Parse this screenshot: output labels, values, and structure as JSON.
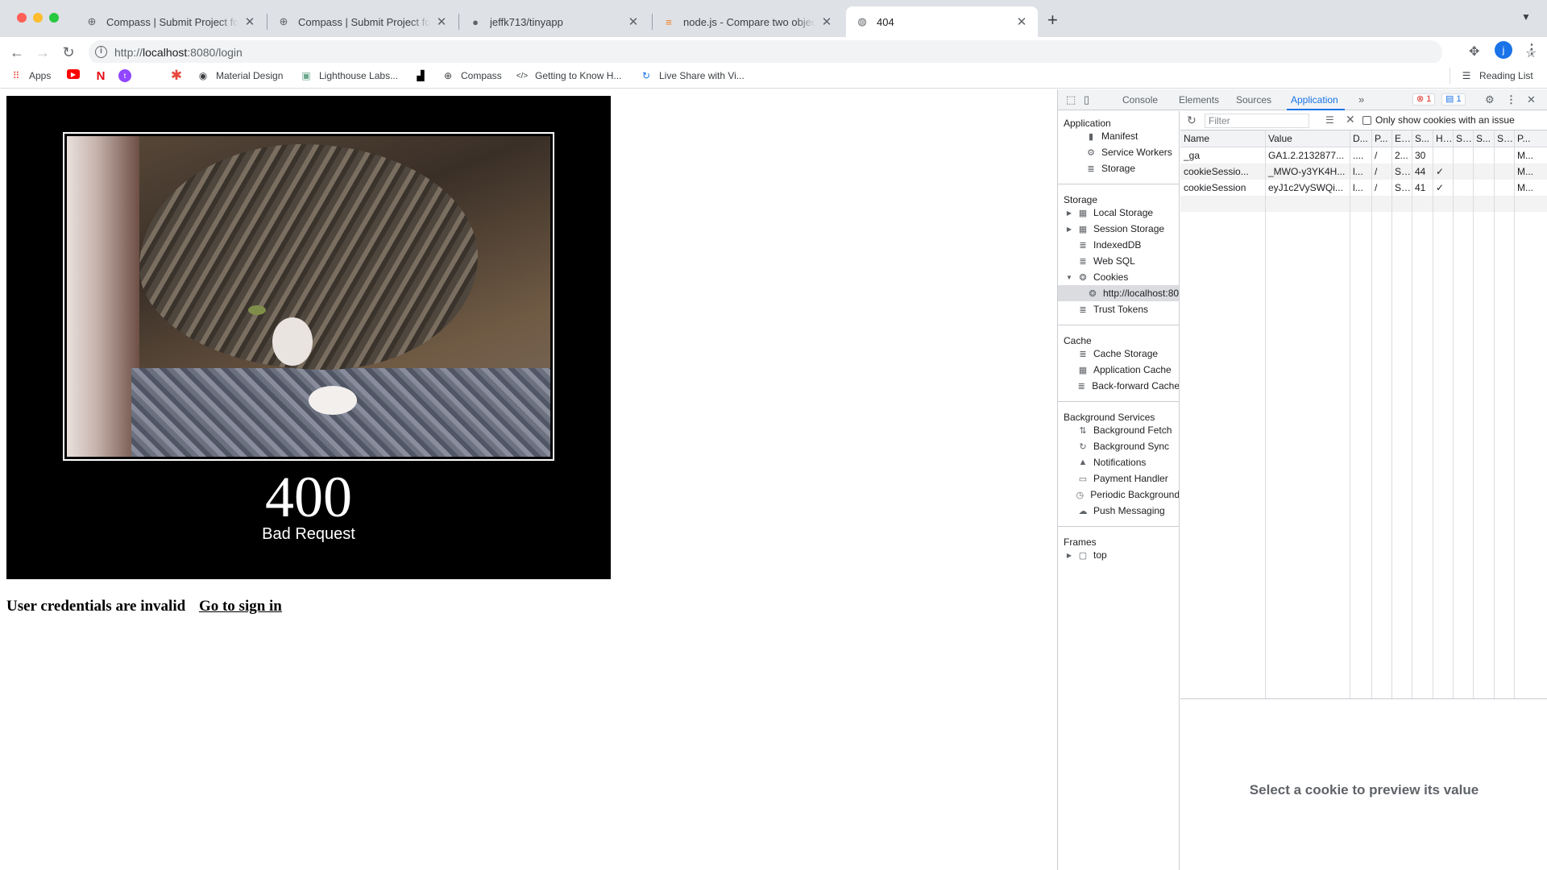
{
  "tabs": [
    {
      "title": "Compass | Submit Project for E",
      "favicon": "compass-icon",
      "active": false
    },
    {
      "title": "Compass | Submit Project for E",
      "favicon": "compass-icon",
      "active": false
    },
    {
      "title": "jeffk713/tinyapp",
      "favicon": "github-icon",
      "active": false
    },
    {
      "title": "node.js - Compare two objects",
      "favicon": "stackoverflow-icon",
      "active": false
    },
    {
      "title": "404",
      "favicon": "globe-icon",
      "active": true
    }
  ],
  "toolbar": {
    "url_host": "localhost",
    "url_prefix": "http://",
    "url_rest": ":8080/login"
  },
  "bookmarks": {
    "items": [
      {
        "label": "Apps",
        "icon": "apps-grid-icon"
      },
      {
        "label": "",
        "icon": "youtube-icon"
      },
      {
        "label": "",
        "icon": "netflix-icon"
      },
      {
        "label": "",
        "icon": "twitch-icon"
      },
      {
        "label": "",
        "icon": "asterisk-icon"
      },
      {
        "label": "Material Design",
        "icon": "material-design-icon"
      },
      {
        "label": "Lighthouse Labs...",
        "icon": "lighthouse-icon"
      },
      {
        "label": "",
        "icon": "unsplash-icon"
      },
      {
        "label": "Compass",
        "icon": "compass-icon"
      },
      {
        "label": "Getting to Know H...",
        "icon": "code-icon"
      },
      {
        "label": "Live Share with Vi...",
        "icon": "liveshare-icon"
      }
    ],
    "reading_list": "Reading List"
  },
  "page": {
    "status_code": "400",
    "status_text": "Bad Request",
    "error_message": "User credentials are invalid",
    "signin_link": "Go to sign in"
  },
  "devtools": {
    "tabs": [
      "Console",
      "Elements",
      "Sources",
      "Application"
    ],
    "active_tab": "Application",
    "error_count": "1",
    "message_count": "1",
    "sidebar": {
      "application_title": "Application",
      "application_items": [
        "Manifest",
        "Service Workers",
        "Storage"
      ],
      "storage_title": "Storage",
      "storage_items": [
        "Local Storage",
        "Session Storage",
        "IndexedDB",
        "Web SQL",
        "Cookies"
      ],
      "cookie_origin": "http://localhost:80",
      "trust_tokens": "Trust Tokens",
      "cache_title": "Cache",
      "cache_items": [
        "Cache Storage",
        "Application Cache",
        "Back-forward Cache"
      ],
      "bg_title": "Background Services",
      "bg_items": [
        "Background Fetch",
        "Background Sync",
        "Notifications",
        "Payment Handler",
        "Periodic Background",
        "Push Messaging"
      ],
      "frames_title": "Frames",
      "frames_top": "top"
    },
    "filter_placeholder": "Filter",
    "only_issue_label": "Only show cookies with an issue",
    "cookie_table": {
      "headers": [
        "Name",
        "Value",
        "D...",
        "P...",
        "E...",
        "S...",
        "H...",
        "S...",
        "S...",
        "S...",
        "P..."
      ],
      "rows": [
        [
          "_ga",
          "GA1.2.2132877...",
          "....",
          "/",
          "2...",
          "30",
          "",
          "",
          "",
          "",
          "M..."
        ],
        [
          "cookieSessio...",
          "_MWO-y3YK4H...",
          "l...",
          "/",
          "S...",
          "44",
          "✓",
          "",
          "",
          "",
          "M..."
        ],
        [
          "cookieSession",
          "eyJ1c2VySWQi...",
          "l...",
          "/",
          "S...",
          "41",
          "✓",
          "",
          "",
          "",
          "M..."
        ]
      ]
    },
    "preview_message": "Select a cookie to preview its value"
  }
}
